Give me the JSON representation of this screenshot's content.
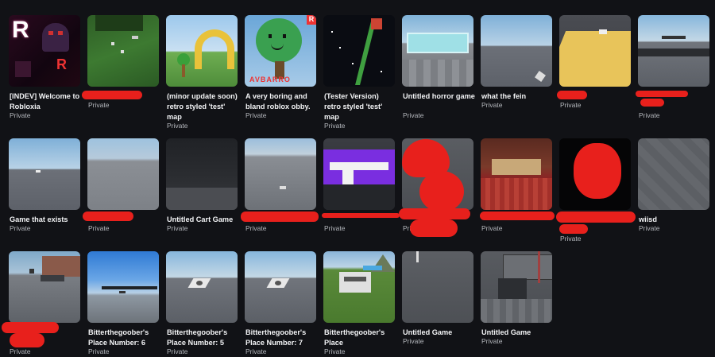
{
  "games": [
    {
      "title": "[INDEV] Welcome to Robloxia",
      "status": "Private"
    },
    {
      "title": "",
      "status": "Private"
    },
    {
      "title": "(minor update soon) retro styled 'test' map",
      "status": "Private"
    },
    {
      "title": "A very boring and bland roblox obby.",
      "status": "Private"
    },
    {
      "title": "(Tester Version) retro styled 'test' map",
      "status": "Private"
    },
    {
      "title": "Untitled horror game",
      "status": "Private"
    },
    {
      "title": "what the fein",
      "status": "Private"
    },
    {
      "title": "",
      "status": "Private"
    },
    {
      "title": "",
      "status": "Private"
    },
    {
      "title": "Game that exists",
      "status": "Private"
    },
    {
      "title": "",
      "status": "Private"
    },
    {
      "title": "Untitled Cart Game",
      "status": "Private"
    },
    {
      "title": "",
      "status": "Private"
    },
    {
      "title": "",
      "status": "Private"
    },
    {
      "title": "",
      "status": "Private"
    },
    {
      "title": "",
      "status": "Private"
    },
    {
      "title": "",
      "status": "Private"
    },
    {
      "title": "wiisd",
      "status": "Private"
    },
    {
      "title": "",
      "status": "Private"
    },
    {
      "title": "Bitterthegoober's Place Number: 6",
      "status": "Private"
    },
    {
      "title": "Bitterthegoober's Place Number: 5",
      "status": "Private"
    },
    {
      "title": "Bitterthegoober's Place Number: 7",
      "status": "Private"
    },
    {
      "title": "Bitterthegoober's Place",
      "status": "Private"
    },
    {
      "title": "Untitled Game",
      "status": "Private"
    },
    {
      "title": "Untitled Game",
      "status": "Private"
    }
  ],
  "thumb_text": {
    "robloxia_logo": "R",
    "obby_banner": "AVBARRO"
  },
  "colors": {
    "background": "#111216",
    "title_text": "#f2f3f5",
    "status_text": "#b5b8bd",
    "redaction": "#e8201c"
  }
}
